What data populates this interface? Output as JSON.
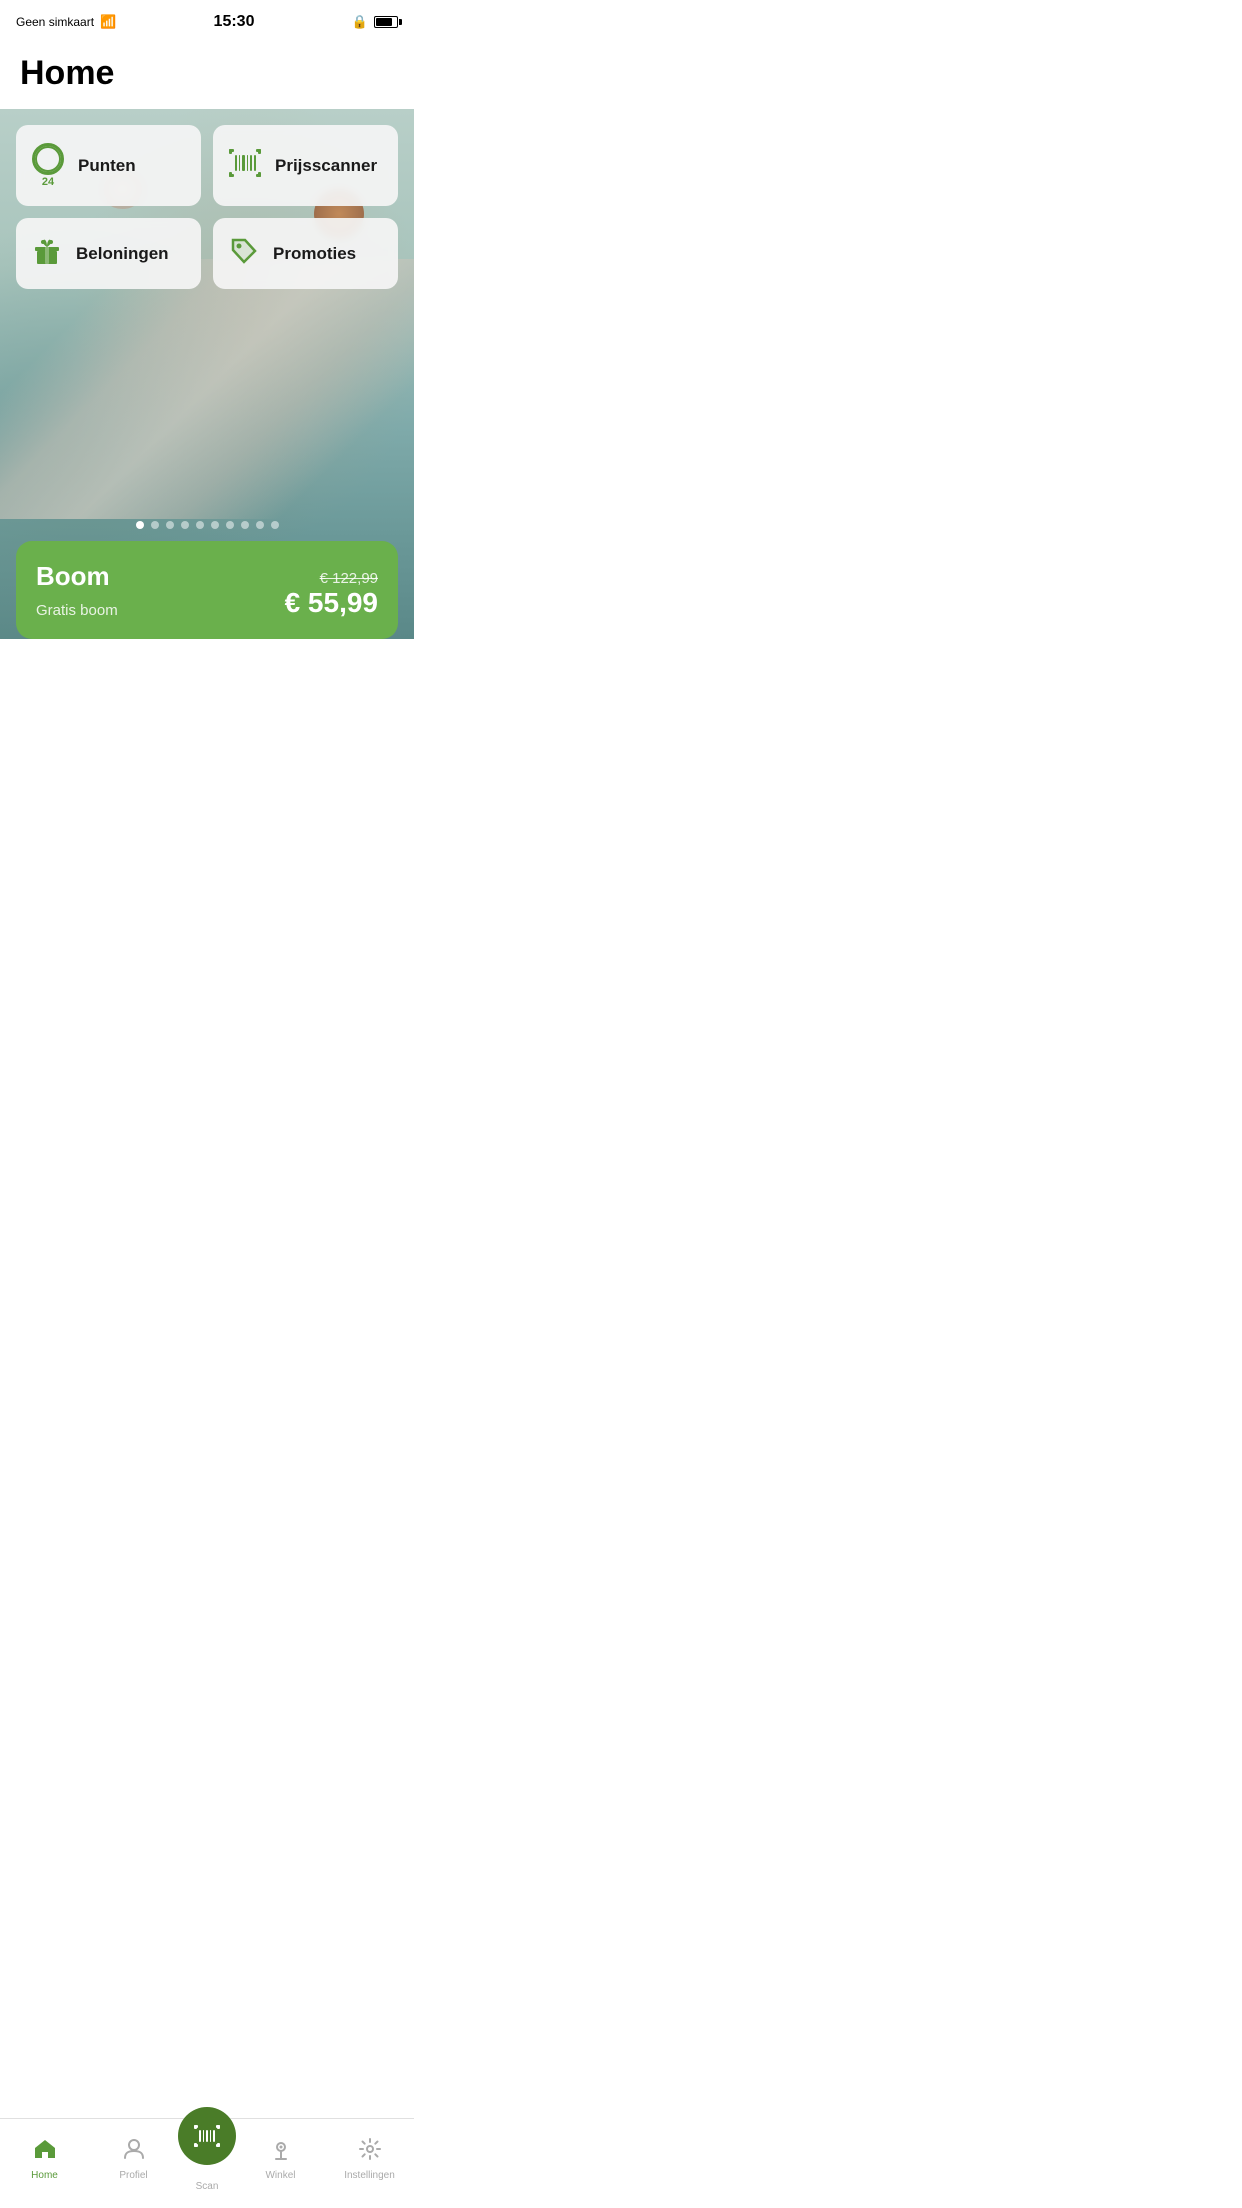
{
  "status_bar": {
    "carrier": "Geen simkaart",
    "time": "15:30"
  },
  "page": {
    "title": "Home"
  },
  "cards": [
    {
      "id": "punten",
      "icon": "points",
      "points_number": "24",
      "label": "Punten"
    },
    {
      "id": "prijsscanner",
      "icon": "barcode",
      "label": "Prijsscanner"
    },
    {
      "id": "beloningen",
      "icon": "gift",
      "label": "Beloningen"
    },
    {
      "id": "promoties",
      "icon": "tag",
      "label": "Promoties"
    }
  ],
  "promo": {
    "title": "Boom",
    "subtitle": "Gratis boom",
    "original_price": "€ 122,99",
    "sale_price": "€ 55,99"
  },
  "dots": {
    "total": 10,
    "active": 0
  },
  "nav": {
    "items": [
      {
        "id": "home",
        "label": "Home",
        "active": true
      },
      {
        "id": "profiel",
        "label": "Profiel",
        "active": false
      },
      {
        "id": "scan",
        "label": "Scan",
        "active": false,
        "center": true
      },
      {
        "id": "winkel",
        "label": "Winkel",
        "active": false
      },
      {
        "id": "instellingen",
        "label": "Instellingen",
        "active": false
      }
    ],
    "scan_label": "Scan"
  },
  "colors": {
    "green": "#5a9a3a",
    "dark_green": "#4a7c28",
    "promo_green": "#6ab04c"
  }
}
